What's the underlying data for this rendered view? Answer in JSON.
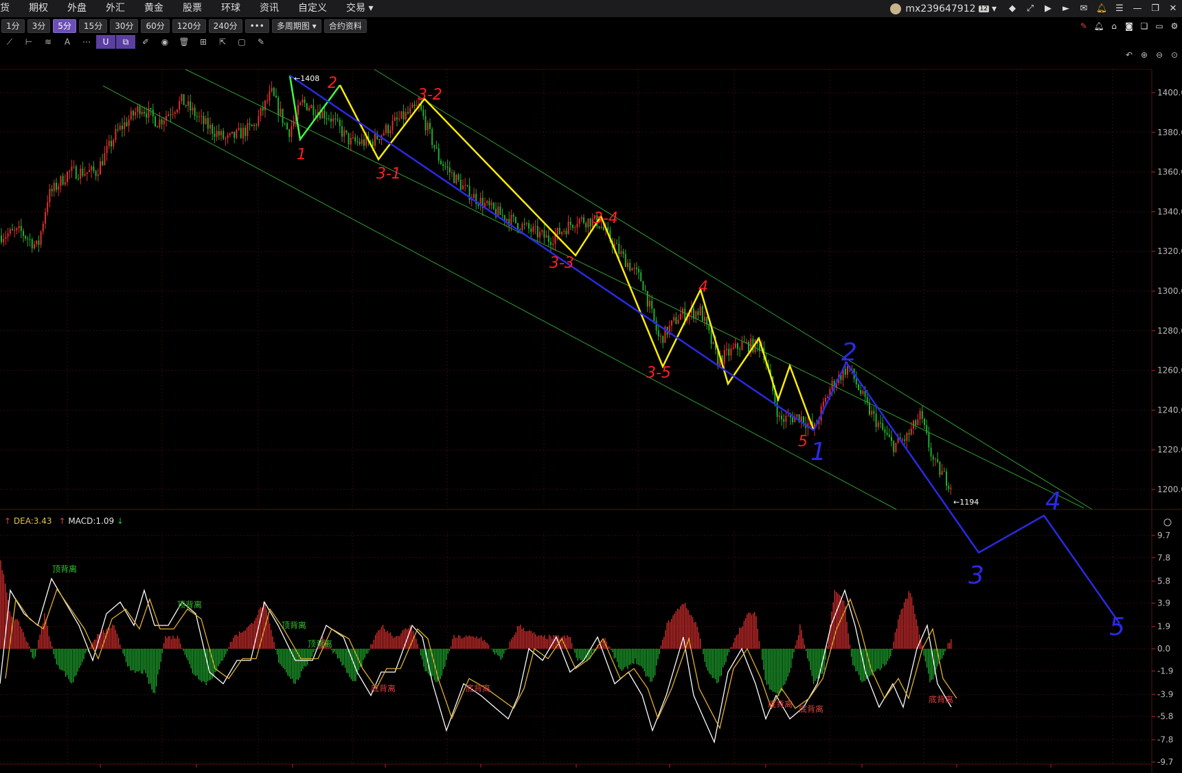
{
  "menu": {
    "items": [
      "货",
      "期权",
      "外盘",
      "外汇",
      "黄金",
      "股票",
      "环球",
      "资讯",
      "自定义",
      "交易"
    ],
    "dropdown_index": 9
  },
  "account": {
    "name": "mx239647912",
    "level": "12"
  },
  "toolbar": {
    "timeframes": [
      "1分",
      "3分",
      "5分",
      "15分",
      "30分",
      "60分",
      "120分",
      "240分",
      "•••",
      "多周期图",
      "合约资料"
    ],
    "active": "5分"
  },
  "price_axis": {
    "min": 1194,
    "max": 1410,
    "ticks": [
      "1400.0",
      "1380.0",
      "1360.0",
      "1340.0",
      "1320.0",
      "1300.0",
      "1280.0",
      "1260.0",
      "1240.0",
      "1220.0",
      "1200.0"
    ],
    "tick_values": [
      1400,
      1380,
      1360,
      1340,
      1320,
      1300,
      1280,
      1260,
      1240,
      1220,
      1200
    ]
  },
  "markers": {
    "high": "1408",
    "low": "1194"
  },
  "macd_header": {
    "dea": "DEA:3.43",
    "macd": "MACD:1.09"
  },
  "macd_axis": {
    "ticks": [
      "9.7",
      "7.8",
      "5.8",
      "3.9",
      "1.9",
      "0.0",
      "-1.9",
      "-3.9",
      "-5.8",
      "-7.8",
      "-9.7"
    ],
    "tick_values": [
      9.7,
      7.8,
      5.8,
      3.9,
      1.9,
      0.0,
      -1.9,
      -3.9,
      -5.8,
      -7.8,
      -9.7
    ]
  },
  "divergence_labels": {
    "top": [
      "顶背离",
      "顶背离",
      "顶背离",
      "顶背离"
    ],
    "bottom": [
      "底背离",
      "底背离",
      "底背离",
      "底背离",
      "底背离"
    ]
  },
  "wave_labels": {
    "red": [
      "1",
      "2",
      "3-1",
      "3-2",
      "3-3",
      "3-4",
      "3-5",
      "4",
      "5"
    ],
    "blue": [
      "1",
      "2",
      "3",
      "4",
      "5"
    ]
  },
  "colors": {
    "up": "#e03030",
    "down": "#20b030",
    "green_line": "#40ff40",
    "yellow_line": "#ffee00",
    "blue_line": "#2a2ae6",
    "channel": "#30a030",
    "grid": "#3a0a0a",
    "dif": "#ffffff",
    "dea": "#e0b030"
  }
}
